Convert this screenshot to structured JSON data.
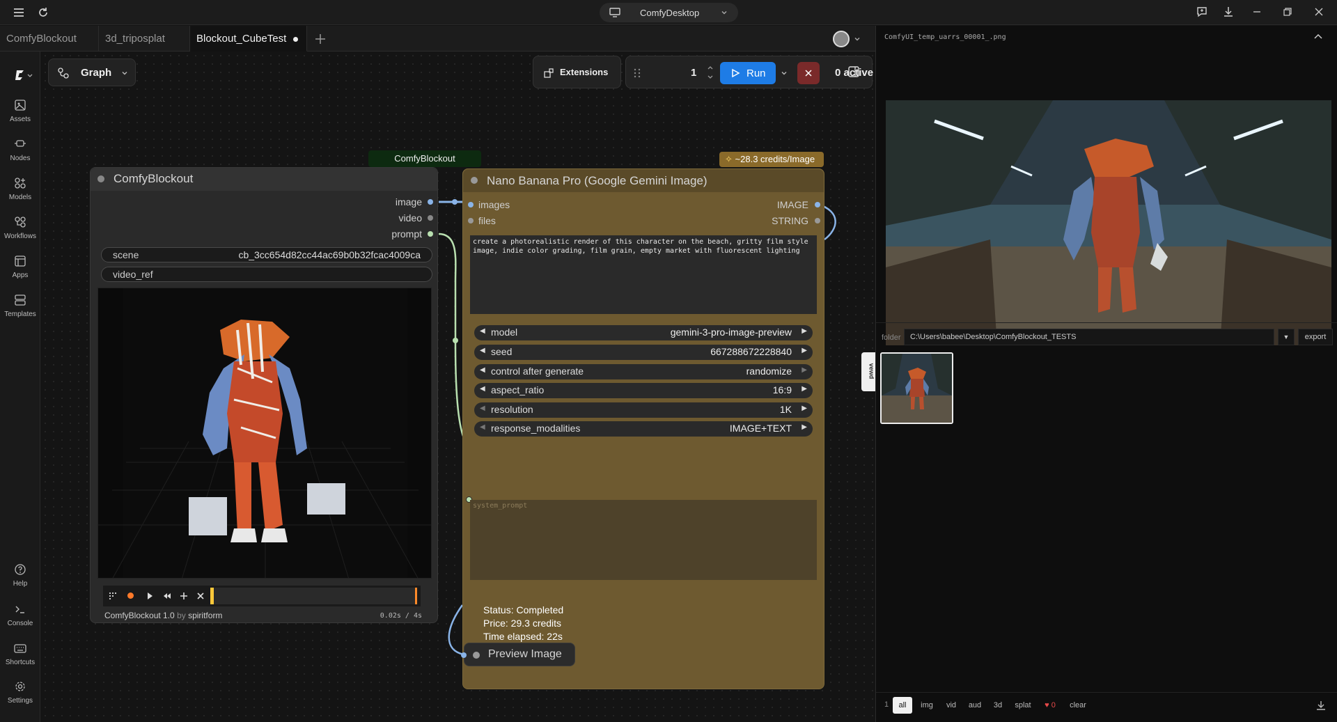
{
  "titlebar": {
    "app_name": "ComfyDesktop"
  },
  "tabs": [
    {
      "label": "ComfyBlockout"
    },
    {
      "label": "3d_triposplat"
    },
    {
      "label": "Blockout_CubeTest"
    }
  ],
  "sidebar": {
    "items": [
      {
        "label": "Assets",
        "icon": "image-icon"
      },
      {
        "label": "Nodes",
        "icon": "nodes-icon"
      },
      {
        "label": "Models",
        "icon": "models-icon"
      },
      {
        "label": "Workflows",
        "icon": "workflows-icon"
      },
      {
        "label": "Apps",
        "icon": "apps-icon"
      },
      {
        "label": "Templates",
        "icon": "templates-icon"
      }
    ],
    "bottom_items": [
      {
        "label": "Help",
        "icon": "help-icon"
      },
      {
        "label": "Console",
        "icon": "terminal-icon"
      },
      {
        "label": "Shortcuts",
        "icon": "keyboard-icon"
      },
      {
        "label": "Settings",
        "icon": "gear-icon"
      }
    ]
  },
  "toolbar": {
    "graph_label": "Graph",
    "extensions_label": "Extensions",
    "batch_count": "1",
    "run_label": "Run",
    "active_label": "0 active"
  },
  "blockout_node": {
    "group_label": "ComfyBlockout",
    "title": "ComfyBlockout",
    "outputs": [
      "image",
      "video",
      "prompt"
    ],
    "scene_label": "scene",
    "scene_value": "cb_3cc654d82cc44ac69b0b32fcac4009ca",
    "video_ref_label": "video_ref",
    "footer_name": "ComfyBlockout 1.0",
    "footer_by": "by",
    "footer_author": "spiritform",
    "time_readout": "0.02s / 4s"
  },
  "nano_node": {
    "credits_badge": "~28.3 credits/Image",
    "title": "Nano Banana Pro (Google Gemini Image)",
    "inputs": [
      "images",
      "files"
    ],
    "outputs": [
      "IMAGE",
      "STRING"
    ],
    "prompt_text": "create a photorealistic render of this character on the beach, gritty film style image, indie color grading, film grain, empty market with fluorescent lighting",
    "widgets": [
      {
        "label": "model",
        "value": "gemini-3-pro-image-preview"
      },
      {
        "label": "seed",
        "value": "667288672228840"
      },
      {
        "label": "control after generate",
        "value": "randomize"
      },
      {
        "label": "aspect_ratio",
        "value": "16:9"
      },
      {
        "label": "resolution",
        "value": "1K"
      },
      {
        "label": "response_modalities",
        "value": "IMAGE+TEXT"
      }
    ],
    "system_prompt_placeholder": "system_prompt",
    "status": "Status: Completed",
    "price": "Price: 29.3 credits",
    "elapsed": "Time elapsed: 22s"
  },
  "preview_node": {
    "title": "Preview Image"
  },
  "right_panel": {
    "filename": "ComfyUI_temp_uarrs_00001_.png",
    "side_tab": "vewd",
    "folder_label": "folder",
    "folder_path": "C:\\Users\\babee\\Desktop\\ComfyBlockout_TESTS",
    "export_label": "export",
    "count": "1",
    "filters": [
      "all",
      "img",
      "vid",
      "aud",
      "3d",
      "splat"
    ],
    "fav_count": "0",
    "clear_label": "clear"
  },
  "colors": {
    "run_blue": "#1e7ce6",
    "nano_body": "#6e5a30",
    "nano_title": "#5a4a28",
    "badge": "#8a6a2a",
    "accent_orange": "#ff8a2a"
  }
}
